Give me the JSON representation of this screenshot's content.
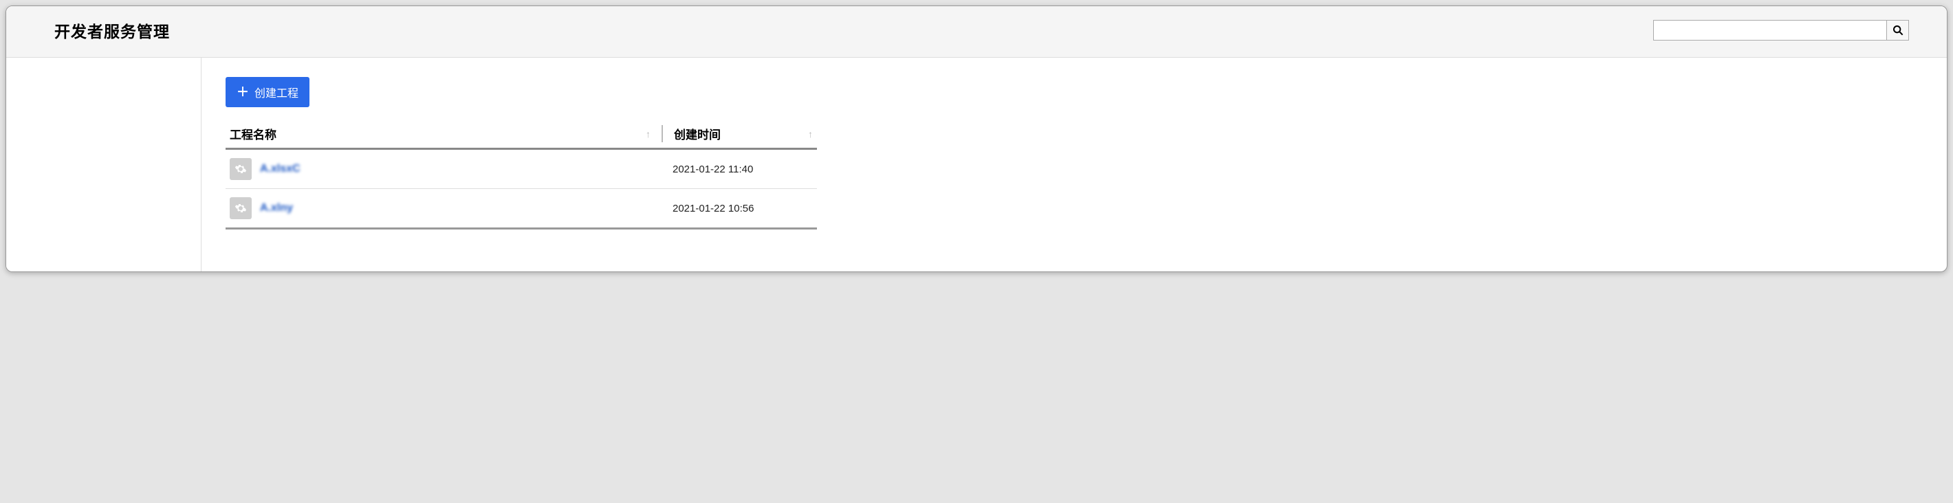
{
  "header": {
    "title": "开发者服务管理",
    "search_placeholder": ""
  },
  "main": {
    "create_button": "创建工程",
    "columns": {
      "name": "工程名称",
      "created": "创建时间"
    },
    "rows": [
      {
        "name": "A.xlsxC",
        "created": "2021-01-22 11:40"
      },
      {
        "name": "A.xlny",
        "created": "2021-01-22 10:56"
      }
    ]
  }
}
